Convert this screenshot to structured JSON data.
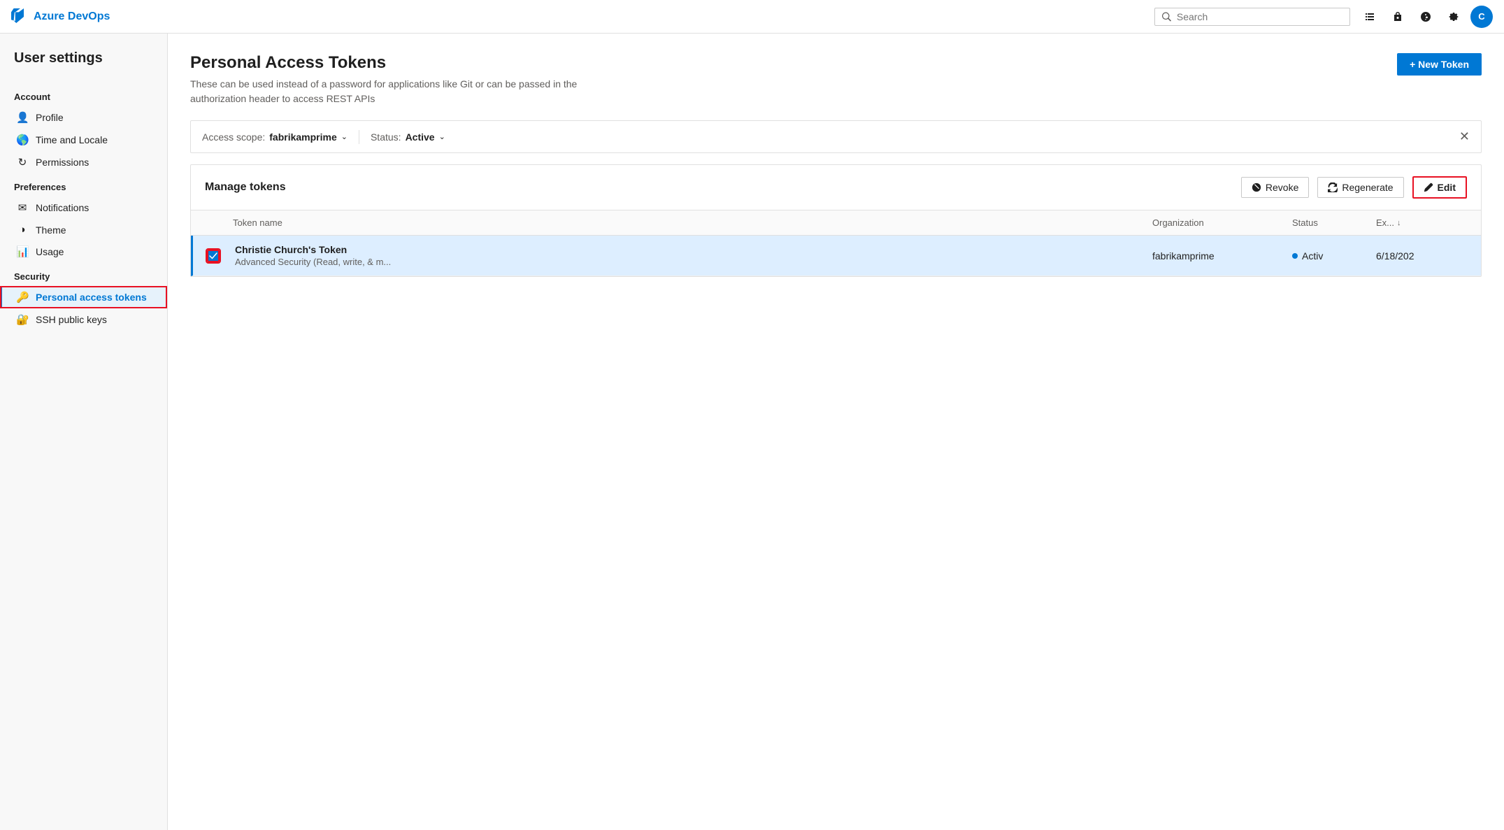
{
  "app": {
    "name": "Azure DevOps",
    "logo_color": "#0078d4"
  },
  "topnav": {
    "search_placeholder": "Search",
    "icons": [
      "list-icon",
      "lock-icon",
      "help-icon",
      "settings-icon"
    ],
    "avatar_initials": "C"
  },
  "sidebar": {
    "title": "User settings",
    "sections": [
      {
        "label": "Account",
        "items": [
          {
            "id": "profile",
            "label": "Profile",
            "icon": "👤"
          },
          {
            "id": "time-locale",
            "label": "Time and Locale",
            "icon": "🌐"
          },
          {
            "id": "permissions",
            "label": "Permissions",
            "icon": "🔄"
          }
        ]
      },
      {
        "label": "Preferences",
        "items": [
          {
            "id": "notifications",
            "label": "Notifications",
            "icon": "🔔"
          },
          {
            "id": "theme",
            "label": "Theme",
            "icon": "🎨"
          },
          {
            "id": "usage",
            "label": "Usage",
            "icon": "📊"
          }
        ]
      },
      {
        "label": "Security",
        "items": [
          {
            "id": "personal-access-tokens",
            "label": "Personal access tokens",
            "icon": "🔑",
            "active": true
          },
          {
            "id": "ssh-public-keys",
            "label": "SSH public keys",
            "icon": "🔐"
          }
        ]
      }
    ]
  },
  "main": {
    "title": "Personal Access Tokens",
    "subtitle": "These can be used instead of a password for applications like Git or can be passed in the authorization header to access REST APIs",
    "new_token_label": "+ New Token",
    "filter": {
      "access_scope_label": "Access scope:",
      "access_scope_value": "fabrikamprime",
      "status_label": "Status:",
      "status_value": "Active"
    },
    "manage": {
      "title": "Manage tokens",
      "revoke_label": "Revoke",
      "regenerate_label": "Regenerate",
      "edit_label": "Edit",
      "table": {
        "columns": [
          {
            "id": "name",
            "label": "Token name"
          },
          {
            "id": "org",
            "label": "Organization"
          },
          {
            "id": "status",
            "label": "Status"
          },
          {
            "id": "expiry",
            "label": "Ex..."
          }
        ],
        "rows": [
          {
            "id": "token-1",
            "name": "Christie Church's Token",
            "description": "Advanced Security (Read, write, & m...",
            "organization": "fabrikamprime",
            "status": "Activ",
            "expiry": "6/18/202",
            "selected": true
          }
        ]
      }
    }
  }
}
